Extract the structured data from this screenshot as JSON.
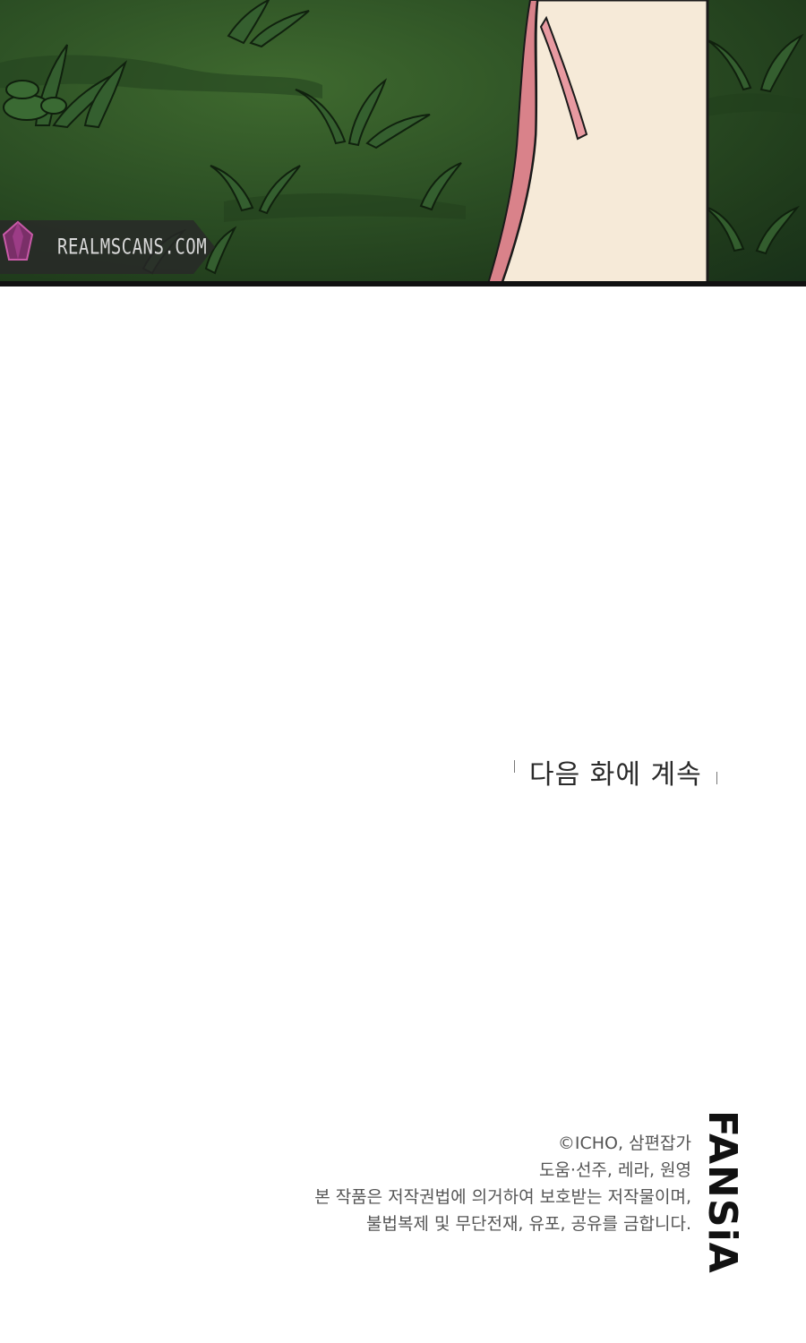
{
  "panel": {
    "watermark_text": "REALMSCANS.COM",
    "colors": {
      "grass_light": "#3f6a2f",
      "grass_dark": "#1f3a1b",
      "skin": "#f6ead8",
      "cloth": "#d9828a"
    }
  },
  "continue": {
    "text": "다음 화에 계속"
  },
  "credits": {
    "line1": "©ICHO, 삼편잡가",
    "line2": "도움·선주, 레라, 원영",
    "line3": "본 작품은 저작권법에 의거하여 보호받는 저작물이며,",
    "line4": "불법복제 및 무단전재, 유포, 공유를 금합니다."
  },
  "brand": {
    "name": "FANSiA"
  }
}
